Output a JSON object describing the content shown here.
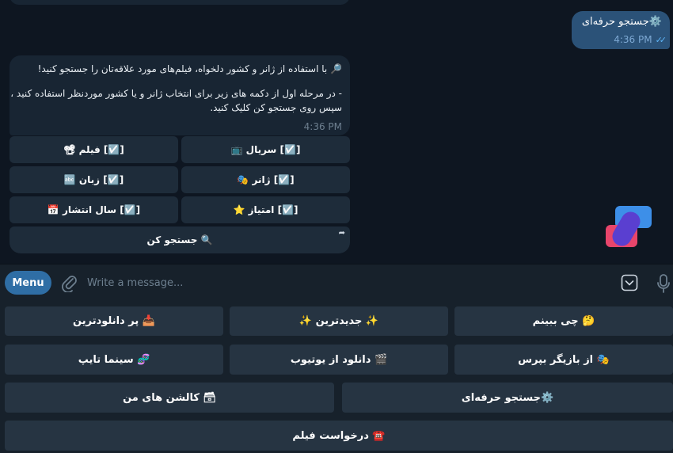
{
  "chat": {
    "outgoing": {
      "text": "⚙️جستجو حرفه‌ای",
      "time": "4:36 PM"
    },
    "incoming": {
      "line1": "🔎 با استفاده از ژانر و کشور دلخواه، فیلم‌های مورد علاقه‌تان را جستجو کنید!",
      "line2": "- در مرحله اول از دکمه های زیر برای انتخاب ژانر و یا کشور موردنظر استفاده کنید ،",
      "line3": "سپس روی جستجو کن کلیک کنید.",
      "time": "4:36 PM"
    },
    "inline_keyboard": [
      [
        "[☑️] سریال 📺",
        "[☑️] فیلم 📽"
      ],
      [
        "[☑️] ژانر 🎭",
        "[☑️] زبان 🔤"
      ],
      [
        "[☑️] امتیاز ⭐",
        "[☑️] سال انتشار 📅"
      ],
      [
        "🔍 جستجو کن"
      ]
    ]
  },
  "input_bar": {
    "menu_label": "Menu",
    "placeholder": "Write a message..."
  },
  "reply_keyboard": {
    "row1": [
      "🤔 چی ببینم",
      "✨ جدیدترین ✨",
      "📥 پر دانلودترین"
    ],
    "row2": [
      "🎭 از بازیگر بپرس",
      "🎬 دانلود از یوتیوب",
      "🧬 سینما تایپ"
    ],
    "row3": [
      "⚙️جستجو حرفه‌ای",
      "🗃 کالشن های من"
    ],
    "row4": [
      "☎️ درخواست فیلم"
    ]
  },
  "colors": {
    "background": "#0e1621",
    "outgoing_bubble": "#2b5278",
    "incoming_bubble": "#182533",
    "accent": "#2f6ea5",
    "button": "#263442"
  }
}
